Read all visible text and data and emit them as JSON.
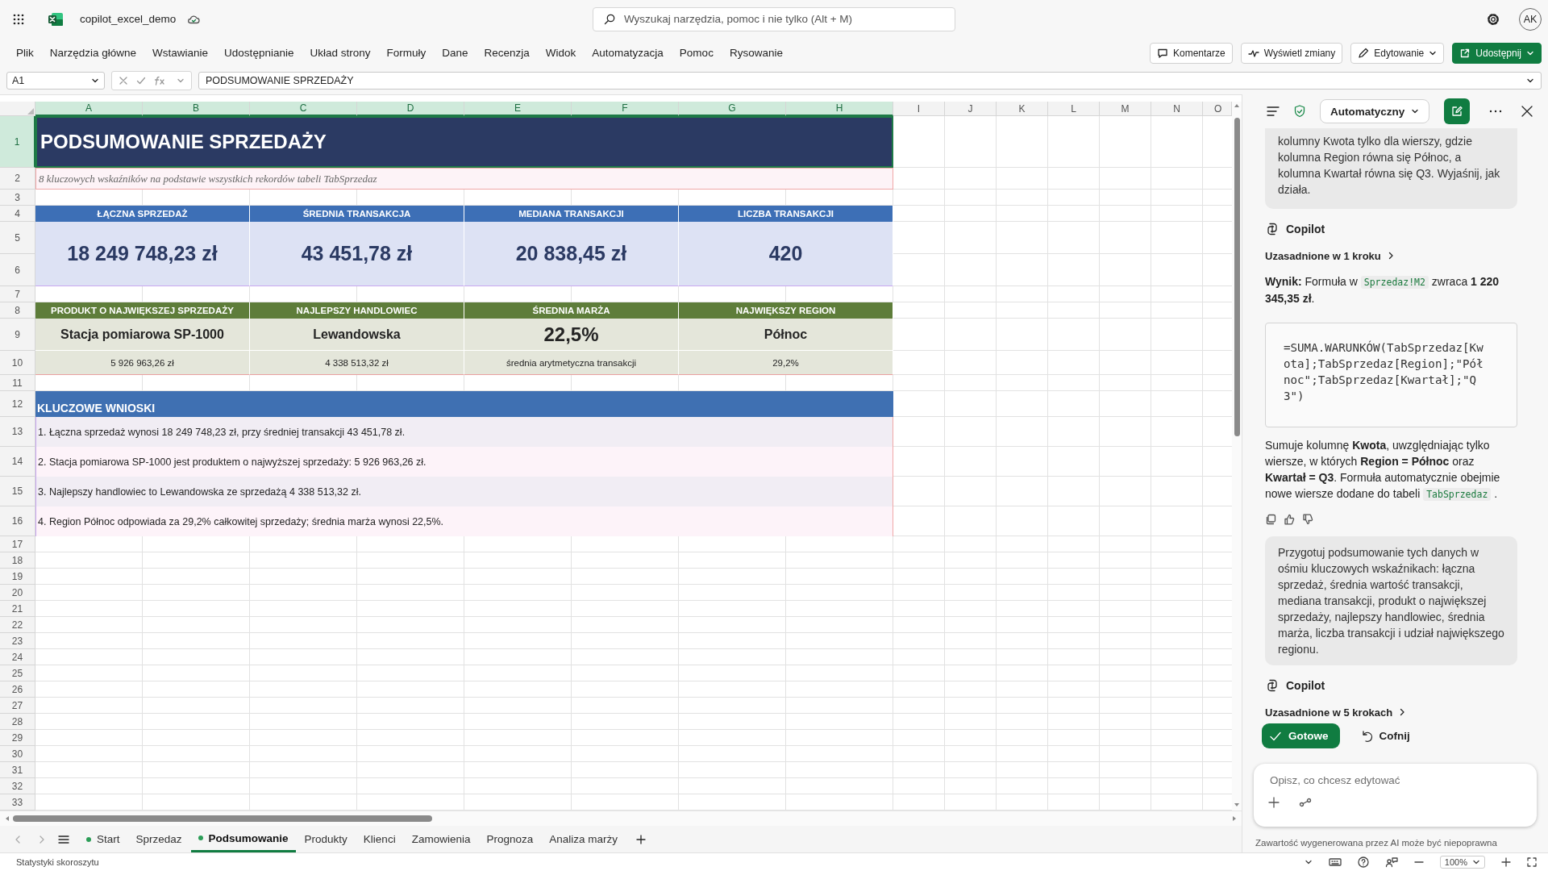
{
  "app": {
    "document_title": "copilot_excel_demo",
    "search_placeholder": "Wyszukaj narzędzia, pomoc i nie tylko (Alt + M)",
    "user_initials": "AK"
  },
  "menu": [
    "Plik",
    "Narzędzia główne",
    "Wstawianie",
    "Udostępnianie",
    "Układ strony",
    "Formuły",
    "Dane",
    "Recenzja",
    "Widok",
    "Automatyzacja",
    "Pomoc",
    "Rysowanie"
  ],
  "actions": [
    {
      "kind": "comments",
      "label": "Komentarze"
    },
    {
      "kind": "changes",
      "label": "Wyświetl zmiany"
    },
    {
      "kind": "editing",
      "label": "Edytowanie"
    },
    {
      "kind": "share",
      "label": "Udostępnij"
    }
  ],
  "formula_bar": {
    "name_box": "A1",
    "formula": "PODSUMOWANIE SPRZEDAŻY"
  },
  "sheet": {
    "columns": [
      {
        "label": "A",
        "selected": true
      },
      {
        "label": "B",
        "selected": true
      },
      {
        "label": "C",
        "selected": true
      },
      {
        "label": "D",
        "selected": true
      },
      {
        "label": "E",
        "selected": true
      },
      {
        "label": "F",
        "selected": true
      },
      {
        "label": "G",
        "selected": true
      },
      {
        "label": "H",
        "selected": true
      },
      {
        "label": "I",
        "selected": false
      },
      {
        "label": "J",
        "selected": false
      },
      {
        "label": "K",
        "selected": false
      },
      {
        "label": "L",
        "selected": false
      },
      {
        "label": "M",
        "selected": false
      },
      {
        "label": "N",
        "selected": false
      }
    ],
    "partial_column": {
      "label": "O",
      "selected": false
    },
    "rows": [
      {
        "label": "1",
        "selected": true
      },
      {
        "label": "2",
        "selected": false
      },
      {
        "label": "3",
        "selected": false
      },
      {
        "label": "4",
        "selected": false
      },
      {
        "label": "5",
        "selected": false
      },
      {
        "label": "6",
        "selected": false
      },
      {
        "label": "7",
        "selected": false
      },
      {
        "label": "8",
        "selected": false
      },
      {
        "label": "9",
        "selected": false
      },
      {
        "label": "10",
        "selected": false
      },
      {
        "label": "11",
        "selected": false
      },
      {
        "label": "12",
        "selected": false
      },
      {
        "label": "13",
        "selected": false
      },
      {
        "label": "14",
        "selected": false
      },
      {
        "label": "15",
        "selected": false
      },
      {
        "label": "16",
        "selected": false
      },
      {
        "label": "17",
        "selected": false
      },
      {
        "label": "18",
        "selected": false
      },
      {
        "label": "19",
        "selected": false
      },
      {
        "label": "20",
        "selected": false
      },
      {
        "label": "21",
        "selected": false
      },
      {
        "label": "22",
        "selected": false
      },
      {
        "label": "23",
        "selected": false
      },
      {
        "label": "24",
        "selected": false
      },
      {
        "label": "25",
        "selected": false
      },
      {
        "label": "26",
        "selected": false
      },
      {
        "label": "27",
        "selected": false
      },
      {
        "label": "28",
        "selected": false
      },
      {
        "label": "29",
        "selected": false
      },
      {
        "label": "30",
        "selected": false
      },
      {
        "label": "31",
        "selected": false
      },
      {
        "label": "32",
        "selected": false
      },
      {
        "label": "33",
        "selected": false
      }
    ],
    "title": "PODSUMOWANIE SPRZEDAŻY",
    "subtitle": "8 kluczowych wskaźników na podstawie wszystkich rekordów tabeli TabSprzedaz",
    "kpis": [
      {
        "header": "ŁĄCZNA SPRZEDAŻ",
        "value": "18 249 748,23 zł"
      },
      {
        "header": "ŚREDNIA TRANSAKCJA",
        "value": "43 451,78 zł"
      },
      {
        "header": "MEDIANA TRANSAKCJI",
        "value": "20 838,45 zł"
      },
      {
        "header": "LICZBA TRANSAKCJI",
        "value": "420"
      }
    ],
    "details": [
      {
        "header": "PRODUKT O NAJWIĘKSZEJ SPRZEDAŻY",
        "value": "Stacja pomiarowa SP-1000",
        "note": "5 926 963,26 zł",
        "large": false
      },
      {
        "header": "NAJLEPSZY HANDLOWIEC",
        "value": "Lewandowska",
        "note": "4 338 513,32 zł",
        "large": false
      },
      {
        "header": "ŚREDNIA MARŻA",
        "value": "22,5%",
        "note": "średnia arytmetyczna transakcji",
        "large": true
      },
      {
        "header": "NAJWIĘKSZY REGION",
        "value": "Północ",
        "note": "29,2%",
        "large": false
      }
    ],
    "insights_header": "KLUCZOWE WNIOSKI",
    "insights": [
      "1. Łączna sprzedaż wynosi 18 249 748,23 zł, przy średniej transakcji 43 451,78 zł.",
      "2. Stacja pomiarowa SP-1000 jest produktem o najwyższej sprzedaży: 5 926 963,26 zł.",
      "3. Najlepszy handlowiec to Lewandowska ze sprzedażą 4 338 513,32 zł.",
      "4. Region Północ odpowiada za 29,2% całkowitej sprzedaży; średnia marża wynosi 22,5%."
    ]
  },
  "sheet_tabs": [
    {
      "label": "Start",
      "dot": true,
      "selected": false
    },
    {
      "label": "Sprzedaz",
      "dot": false,
      "selected": false
    },
    {
      "label": "Podsumowanie",
      "dot": true,
      "selected": true
    },
    {
      "label": "Produkty",
      "dot": false,
      "selected": false
    },
    {
      "label": "Klienci",
      "dot": false,
      "selected": false
    },
    {
      "label": "Zamowienia",
      "dot": false,
      "selected": false
    },
    {
      "label": "Prognoza",
      "dot": false,
      "selected": false
    },
    {
      "label": "Analiza marży",
      "dot": false,
      "selected": false
    }
  ],
  "copilot": {
    "mode": "Automatyczny",
    "messages": [
      {
        "kind": "user",
        "text": "kolumny Kwota tylko dla wierszy, gdzie kolumna Region równa się Północ, a kolumna Kwartał równa się Q3. Wyjaśnij, jak działa."
      },
      {
        "kind": "author",
        "text": "Copilot"
      },
      {
        "kind": "grounding",
        "text": "Uzasadnione w 1 kroku"
      },
      {
        "kind": "paragraph",
        "parts": [
          {
            "kind": "text",
            "text": "**Wynik:** Formuła w "
          },
          {
            "kind": "code",
            "text": "Sprzedaz!M2"
          },
          {
            "kind": "text",
            "text": " zwraca **1 220 345,35 zł**."
          }
        ]
      },
      {
        "kind": "code_block",
        "text": "=SUMA.WARUNKÓW(TabSprzedaz[Kwota];TabSprzedaz[Region];\"Północ\";TabSprzedaz[Kwartał];\"Q3\")"
      },
      {
        "kind": "paragraph",
        "parts": [
          {
            "kind": "text",
            "text": "Sumuje kolumnę **Kwota**, uwzględniając tylko wiersze, w których **Region = Północ** oraz **Kwartał = Q3**. Formuła automatycznie obejmie nowe wiersze dodane do tabeli "
          },
          {
            "kind": "code",
            "text": "TabSprzedaz"
          },
          {
            "kind": "text",
            "text": " ."
          }
        ]
      },
      {
        "kind": "feedback"
      },
      {
        "kind": "user",
        "text": "Przygotuj podsumowanie tych danych w ośmiu kluczowych wskaźnikach: łączna sprzedaż, średnia wartość transakcji, mediana transakcji, produkt o największej sprzedaży, najlepszy handlowiec, średnia marża, liczba transakcji i udział największego regionu."
      },
      {
        "kind": "author",
        "text": "Copilot"
      },
      {
        "kind": "grounding",
        "text": "Uzasadnione w 5 krokach"
      },
      {
        "kind": "actions",
        "buttons": [
          {
            "kind": "primary",
            "label": "Gotowe"
          },
          {
            "kind": "undo",
            "label": "Cofnij"
          }
        ]
      }
    ],
    "input_placeholder": "Opisz, co chcesz edytować",
    "disclaimer": "Zawartość wygenerowana przez AI może być niepoprawna"
  },
  "status_bar": {
    "text": "Statystyki skoroszytu",
    "zoom": "100%"
  }
}
